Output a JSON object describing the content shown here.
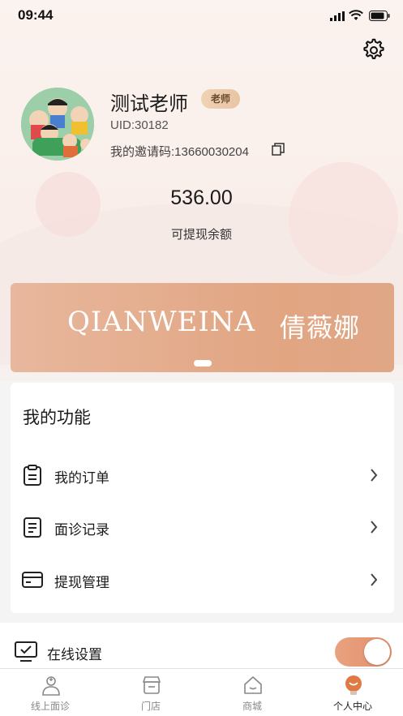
{
  "status_bar": {
    "time": "09:44"
  },
  "profile": {
    "name": "测试老师",
    "role_badge": "老师",
    "uid": "UID:30182",
    "invite_code": "我的邀请码:13660030204"
  },
  "balance": {
    "amount": "536.00",
    "label": "可提现余额"
  },
  "banner": {
    "brand_en": "QIANWEINA",
    "brand_cn": "倩薇娜",
    "active_slide": 1
  },
  "functions": {
    "title": "我的功能",
    "items": [
      {
        "label": "我的订单",
        "icon": "clipboard-icon"
      },
      {
        "label": "面诊记录",
        "icon": "document-icon"
      },
      {
        "label": "提现管理",
        "icon": "wallet-icon"
      }
    ]
  },
  "online_setting": {
    "label": "在线设置",
    "enabled": true,
    "icon": "monitor-check-icon"
  },
  "tabbar": {
    "items": [
      {
        "label": "线上面诊",
        "icon": "doctor-icon",
        "active": false
      },
      {
        "label": "门店",
        "icon": "store-icon",
        "active": false
      },
      {
        "label": "商城",
        "icon": "home-icon",
        "active": false
      },
      {
        "label": "个人中心",
        "icon": "user-center-icon",
        "active": true
      }
    ]
  },
  "colors": {
    "accent": "#e38f6b",
    "badge": "#e8c4a4",
    "active_tab": "#e07a45"
  }
}
